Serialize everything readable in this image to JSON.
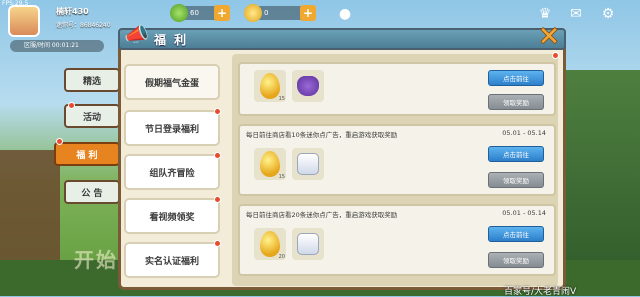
{
  "status": {
    "fps": "FPS:29.5"
  },
  "user": {
    "name": "楠轩430",
    "id": "迷你号：86846240"
  },
  "currencies": [
    {
      "icon": "mini-bean-icon",
      "value": "60"
    },
    {
      "icon": "mini-coin-icon",
      "value": "0"
    }
  ],
  "server_bar": {
    "text": "区服/时间 00:01:21"
  },
  "side_tabs": [
    {
      "label": "精选",
      "active": false
    },
    {
      "label": "活动",
      "active": false
    },
    {
      "label": "福 利",
      "active": true
    },
    {
      "label": "公 告",
      "active": false
    }
  ],
  "panel": {
    "title": "福 利"
  },
  "menu": [
    {
      "label": "假期福气金蛋"
    },
    {
      "label": "节日登录福利"
    },
    {
      "label": "组队齐冒险"
    },
    {
      "label": "看视频领奖"
    },
    {
      "label": "实名认证福利"
    }
  ],
  "cards": [
    {
      "desc": "",
      "date": "",
      "items": [
        {
          "icon": "golden-egg-icon",
          "count": "15"
        },
        {
          "icon": "lucky-bag-icon",
          "count": ""
        }
      ],
      "go_label": "点击前往",
      "claim_label": "领取奖励"
    },
    {
      "desc": "每日前往商店看10条迷你点广告，重启游戏获取奖励",
      "date": "05.01 - 05.14",
      "items": [
        {
          "icon": "golden-egg-icon",
          "count": "15"
        },
        {
          "icon": "cube-pet-icon",
          "count": ""
        }
      ],
      "go_label": "点击前往",
      "claim_label": "领取奖励"
    },
    {
      "desc": "每日前往商店看20条迷你点广告，重启游戏获取奖励",
      "date": "05.01 - 05.14",
      "items": [
        {
          "icon": "golden-egg-icon",
          "count": "20"
        },
        {
          "icon": "gift-cube-icon",
          "count": ""
        }
      ],
      "go_label": "点击前往",
      "claim_label": "领取奖励"
    }
  ],
  "background": {
    "start_text": "开始游"
  },
  "watermark": "百家号/大老青闹V"
}
